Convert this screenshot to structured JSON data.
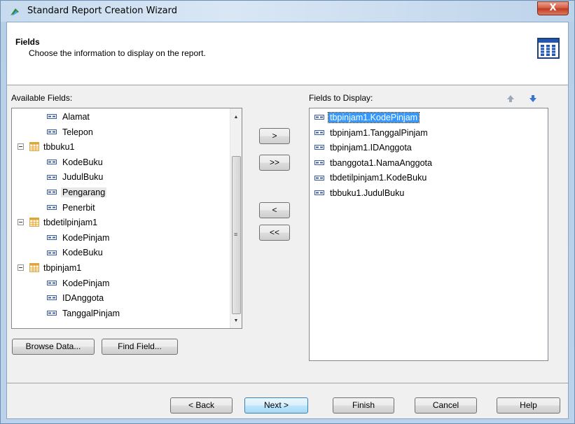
{
  "window": {
    "title": "Standard Report Creation Wizard",
    "close_label": "X"
  },
  "header": {
    "title": "Fields",
    "subtitle": "Choose the information to display on the report."
  },
  "available": {
    "label": "Available Fields:",
    "items": [
      {
        "type": "field",
        "label": "Alamat"
      },
      {
        "type": "field",
        "label": "Telepon"
      },
      {
        "type": "table",
        "label": "tbbuku1"
      },
      {
        "type": "field",
        "label": "KodeBuku"
      },
      {
        "type": "field",
        "label": "JudulBuku"
      },
      {
        "type": "field",
        "label": "Pengarang",
        "highlighted": true
      },
      {
        "type": "field",
        "label": "Penerbit"
      },
      {
        "type": "table",
        "label": "tbdetilpinjam1"
      },
      {
        "type": "field",
        "label": "KodePinjam"
      },
      {
        "type": "field",
        "label": "KodeBuku"
      },
      {
        "type": "table",
        "label": "tbpinjam1"
      },
      {
        "type": "field",
        "label": "KodePinjam"
      },
      {
        "type": "field",
        "label": "IDAnggota"
      },
      {
        "type": "field",
        "label": "TanggalPinjam"
      }
    ]
  },
  "display": {
    "label": "Fields to Display:",
    "items": [
      {
        "label": "tbpinjam1.KodePinjam",
        "selected": true
      },
      {
        "label": "tbpinjam1.TanggalPinjam"
      },
      {
        "label": "tbpinjam1.IDAnggota"
      },
      {
        "label": "tbanggota1.NamaAnggota"
      },
      {
        "label": "tbdetilpinjam1.KodeBuku"
      },
      {
        "label": "tbbuku1.JudulBuku"
      }
    ]
  },
  "move_buttons": {
    "add_one": ">",
    "add_all": ">>",
    "remove_one": "<",
    "remove_all": "<<"
  },
  "left_buttons": {
    "browse_data": "Browse Data...",
    "find_field": "Find Field..."
  },
  "footer": {
    "back": "< Back",
    "next": "Next >",
    "finish": "Finish",
    "cancel": "Cancel",
    "help": "Help"
  },
  "colors": {
    "selection": "#3399ff",
    "field_icon": "#3b5ba0",
    "table_icon": "#e0a43a",
    "move_up_icon": "#9aa9b8",
    "move_down_icon": "#3a74d0"
  }
}
